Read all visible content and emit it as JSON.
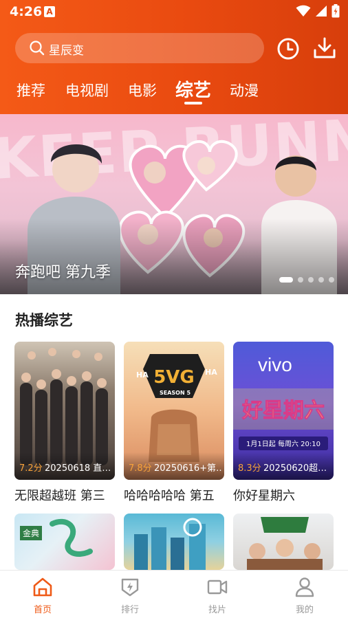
{
  "status_bar": {
    "time": "4:26",
    "notification_letter": "A"
  },
  "search": {
    "placeholder": "星辰变"
  },
  "tabs": [
    {
      "label": "推荐"
    },
    {
      "label": "电视剧"
    },
    {
      "label": "电影"
    },
    {
      "label": "综艺",
      "active": true
    },
    {
      "label": "动漫"
    }
  ],
  "banner": {
    "title": "奔跑吧 第九季",
    "background_text": "KEEP RUNNING",
    "slide_count": 5,
    "active_slide": 1
  },
  "section": {
    "title": "热播综艺"
  },
  "cards": [
    {
      "score": "7.2分",
      "meta": "20250618 直…",
      "title": "无限超越班 第三",
      "thumb_label": ""
    },
    {
      "score": "7.8分",
      "meta": "20250616+第…",
      "title": "哈哈哈哈哈 第五",
      "thumb_label": "SEASON 5"
    },
    {
      "score": "8.3分",
      "meta": "20250620超…",
      "title": "你好星期六",
      "thumb_label": "vivo"
    },
    {
      "score": "",
      "meta": "",
      "title": "",
      "thumb_label": "金典"
    },
    {
      "score": "",
      "meta": "",
      "title": "",
      "thumb_label": ""
    },
    {
      "score": "",
      "meta": "",
      "title": "",
      "thumb_label": ""
    }
  ],
  "bottom_nav": [
    {
      "label": "首页",
      "icon": "home-icon",
      "active": true
    },
    {
      "label": "排行",
      "icon": "ranking-icon"
    },
    {
      "label": "找片",
      "icon": "video-camera-icon"
    },
    {
      "label": "我的",
      "icon": "profile-icon"
    }
  ],
  "colors": {
    "accent": "#ef5a17",
    "header_start": "#f45a17",
    "header_end": "#d73e0b",
    "score": "#f7a23a"
  }
}
